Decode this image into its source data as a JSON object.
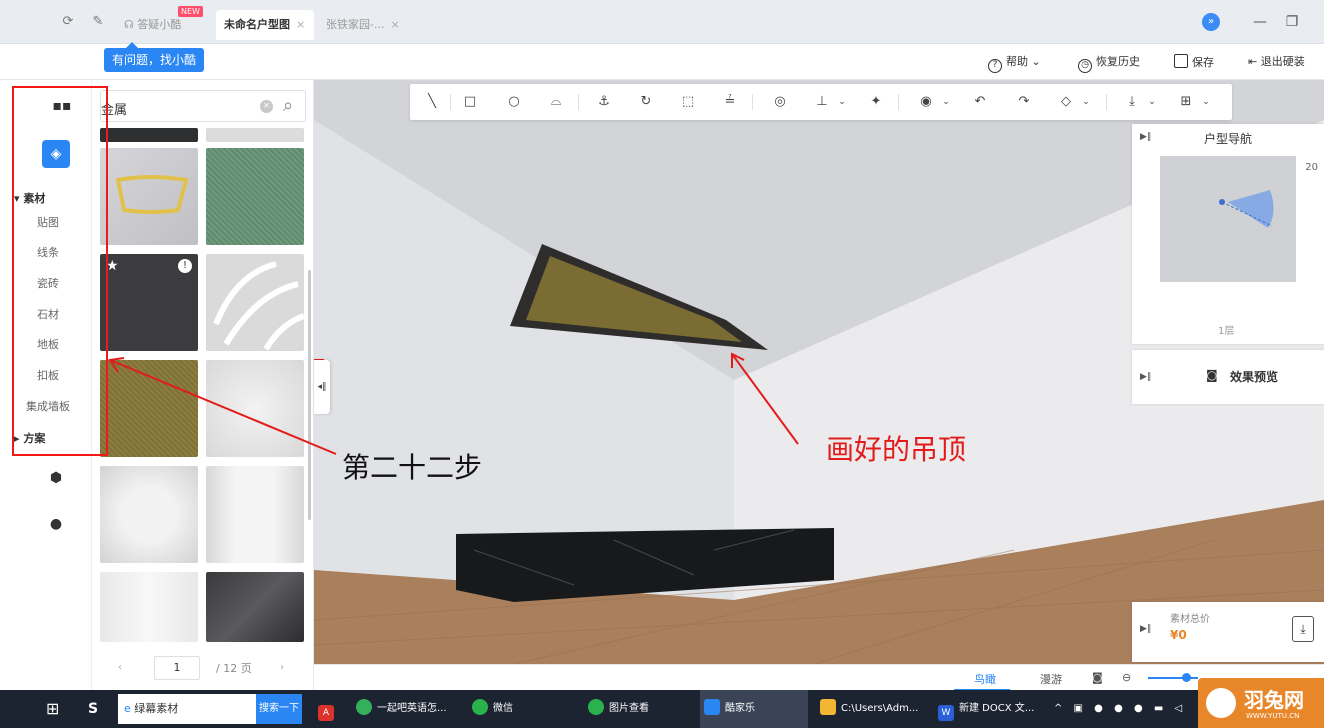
{
  "tabs": {
    "help_app": "答疑小酷",
    "new_badge": "NEW",
    "active_tab": "未命名户型图",
    "inactive_tab": "张铁家园-...",
    "close": "×",
    "help_tip": "有问题，找小酷"
  },
  "header": {
    "help": "帮助",
    "history": "恢复历史",
    "save": "保存",
    "exit": "退出硬装"
  },
  "sidebar": {
    "section_material": "▾ 素材",
    "items": [
      "贴图",
      "线条",
      "瓷砖",
      "石材",
      "地板",
      "扣板",
      "集成墙板"
    ],
    "section_plan": "▸ 方案"
  },
  "panel": {
    "search_value": "金属",
    "page_current": "1",
    "page_total": "/ 12 页"
  },
  "toolbar": {
    "icons": [
      "line-tool-icon",
      "rect-tool-icon",
      "circle-tool-icon",
      "arc-tool-icon",
      "anchor-tool-icon",
      "rotate-tool-icon",
      "frame-tool-icon",
      "align-tool-icon",
      "camera-tool-icon",
      "distribute-tool-icon",
      "brush-tool-icon",
      "eye-tool-icon",
      "undo-tool-icon",
      "redo-tool-icon",
      "eraser-tool-icon",
      "download-tool-icon",
      "map-tool-icon"
    ]
  },
  "annotations": {
    "step": "第二十二步",
    "ceiling": "画好的吊顶"
  },
  "right_panels": {
    "nav_title": "户型导航",
    "nav_badge": "20",
    "floor": "1层",
    "preview": "效果预览",
    "price_label": "素材总价",
    "price_value": "¥0"
  },
  "bottom": {
    "tab_birdseye": "鸟瞰",
    "tab_roam": "漫游"
  },
  "taskbar": {
    "search_text": "绿幕素材",
    "search_btn": "搜索一下",
    "apps": [
      "一起吧英语怎...",
      "微信",
      "图片查看",
      "酷家乐",
      "C:\\Users\\Adm...",
      "新建 DOCX 文..."
    ]
  },
  "watermark": {
    "brand": "羽兔网",
    "url": "WWW.YUTU.CN"
  },
  "colors": {
    "accent": "#2a86f3",
    "annotation_red": "#f01818",
    "taskbar": "#1c2432",
    "watermark": "#e8862a"
  }
}
